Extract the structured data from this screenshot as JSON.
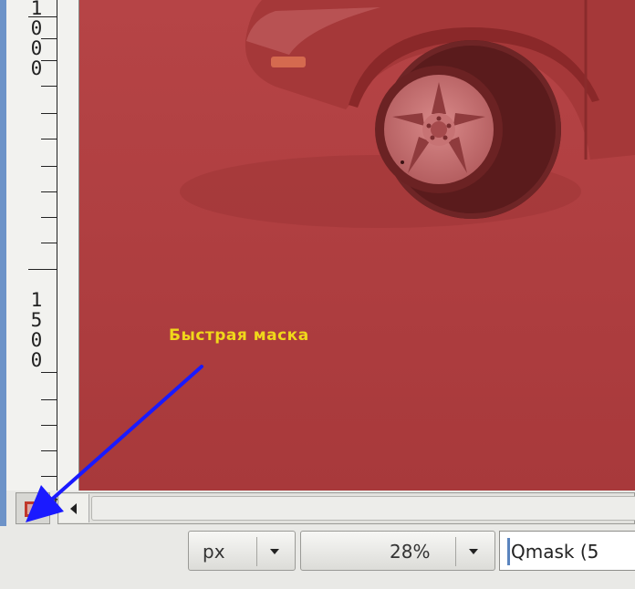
{
  "ruler": {
    "label_top": "1000",
    "label_mid": "1500"
  },
  "canvas": {
    "overlay_color": "#b13e3f",
    "content": "quick-mask-overlay-car-wheel"
  },
  "annotation": {
    "label": "Быстрая маска",
    "label_color": "#f0d81a",
    "arrow_color": "#1a1aff"
  },
  "statusbar": {
    "unit": "px",
    "zoom": "28%",
    "message": "Qmask (5"
  },
  "icons": {
    "quick_mask_toggle": "quick-mask-icon",
    "navigate": "navigate-icon",
    "scroll_left": "arrow-left-icon",
    "dropdown": "chevron-down-icon"
  }
}
